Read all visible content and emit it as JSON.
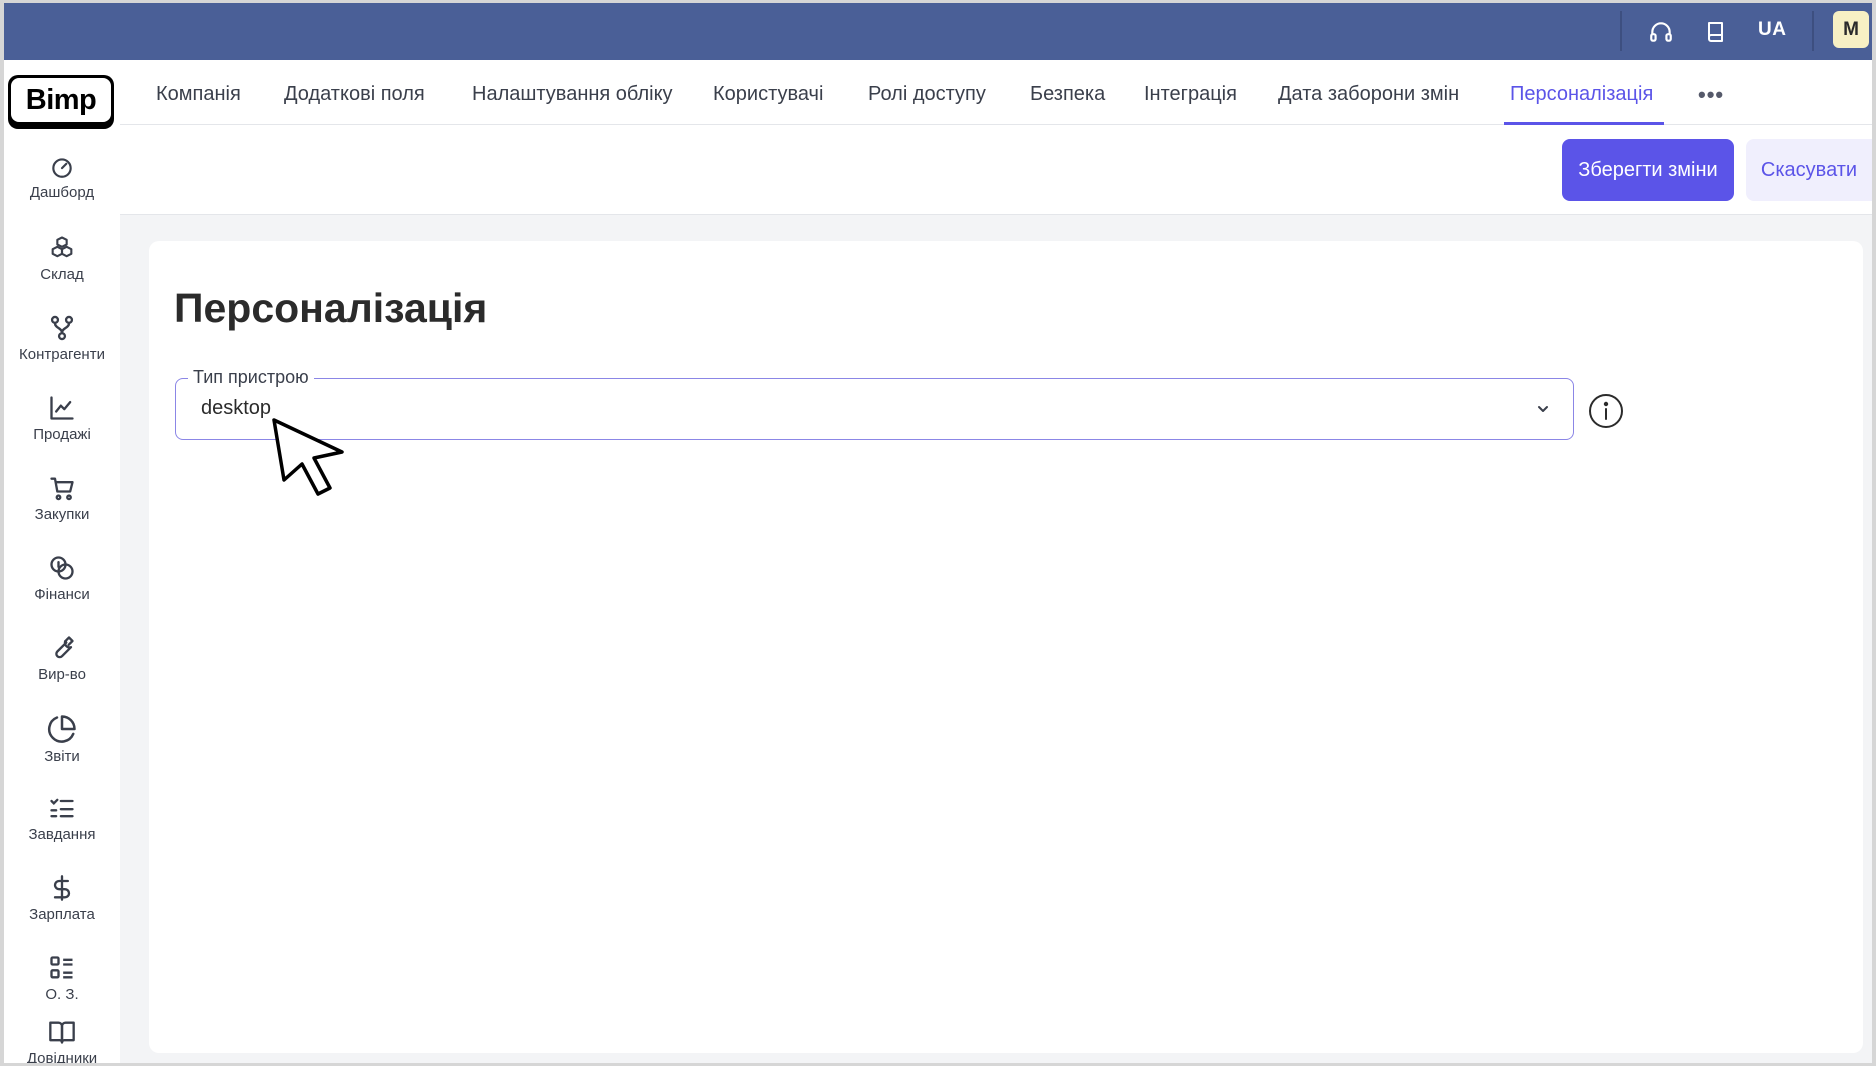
{
  "topbar": {
    "support_icon": "headset-icon",
    "docs_icon": "book-icon",
    "language": "UA",
    "avatar_initial": "M",
    "bg_color": "#4a5f97"
  },
  "sidebar": {
    "logo_text": "Bimp",
    "items": [
      {
        "label": "Дашборд",
        "icon": "gauge-icon"
      },
      {
        "label": "Склад",
        "icon": "boxes-icon"
      },
      {
        "label": "Контрагенти",
        "icon": "network-icon"
      },
      {
        "label": "Продажі",
        "icon": "line-chart-icon"
      },
      {
        "label": "Закупки",
        "icon": "cart-icon"
      },
      {
        "label": "Фінанси",
        "icon": "coins-icon"
      },
      {
        "label": "Вир-во",
        "icon": "wrench-icon"
      },
      {
        "label": "Звіти",
        "icon": "pie-chart-icon"
      },
      {
        "label": "Завдання",
        "icon": "checklist-icon"
      },
      {
        "label": "Зарплата",
        "icon": "dollar-icon"
      },
      {
        "label": "О. З.",
        "icon": "grid-list-icon"
      },
      {
        "label": "Довідники",
        "icon": "open-book-icon"
      }
    ]
  },
  "tabs": [
    {
      "label": "Компанія"
    },
    {
      "label": "Додаткові поля"
    },
    {
      "label": "Налаштування обліку"
    },
    {
      "label": "Користувачі"
    },
    {
      "label": "Ролі доступу"
    },
    {
      "label": "Безпека"
    },
    {
      "label": "Інтеграція"
    },
    {
      "label": "Дата заборони змін"
    },
    {
      "label": "Персоналізація",
      "active": true
    }
  ],
  "tabs_more": "•••",
  "actions": {
    "save_label": "Зберегти зміни",
    "cancel_label": "Скасувати"
  },
  "main": {
    "title": "Персоналізація",
    "device_field": {
      "label": "Тип пристрою",
      "value": "desktop"
    }
  },
  "colors": {
    "accent": "#5b54e8",
    "topbar": "#4a5f97",
    "content_bg": "#f3f4f6"
  }
}
